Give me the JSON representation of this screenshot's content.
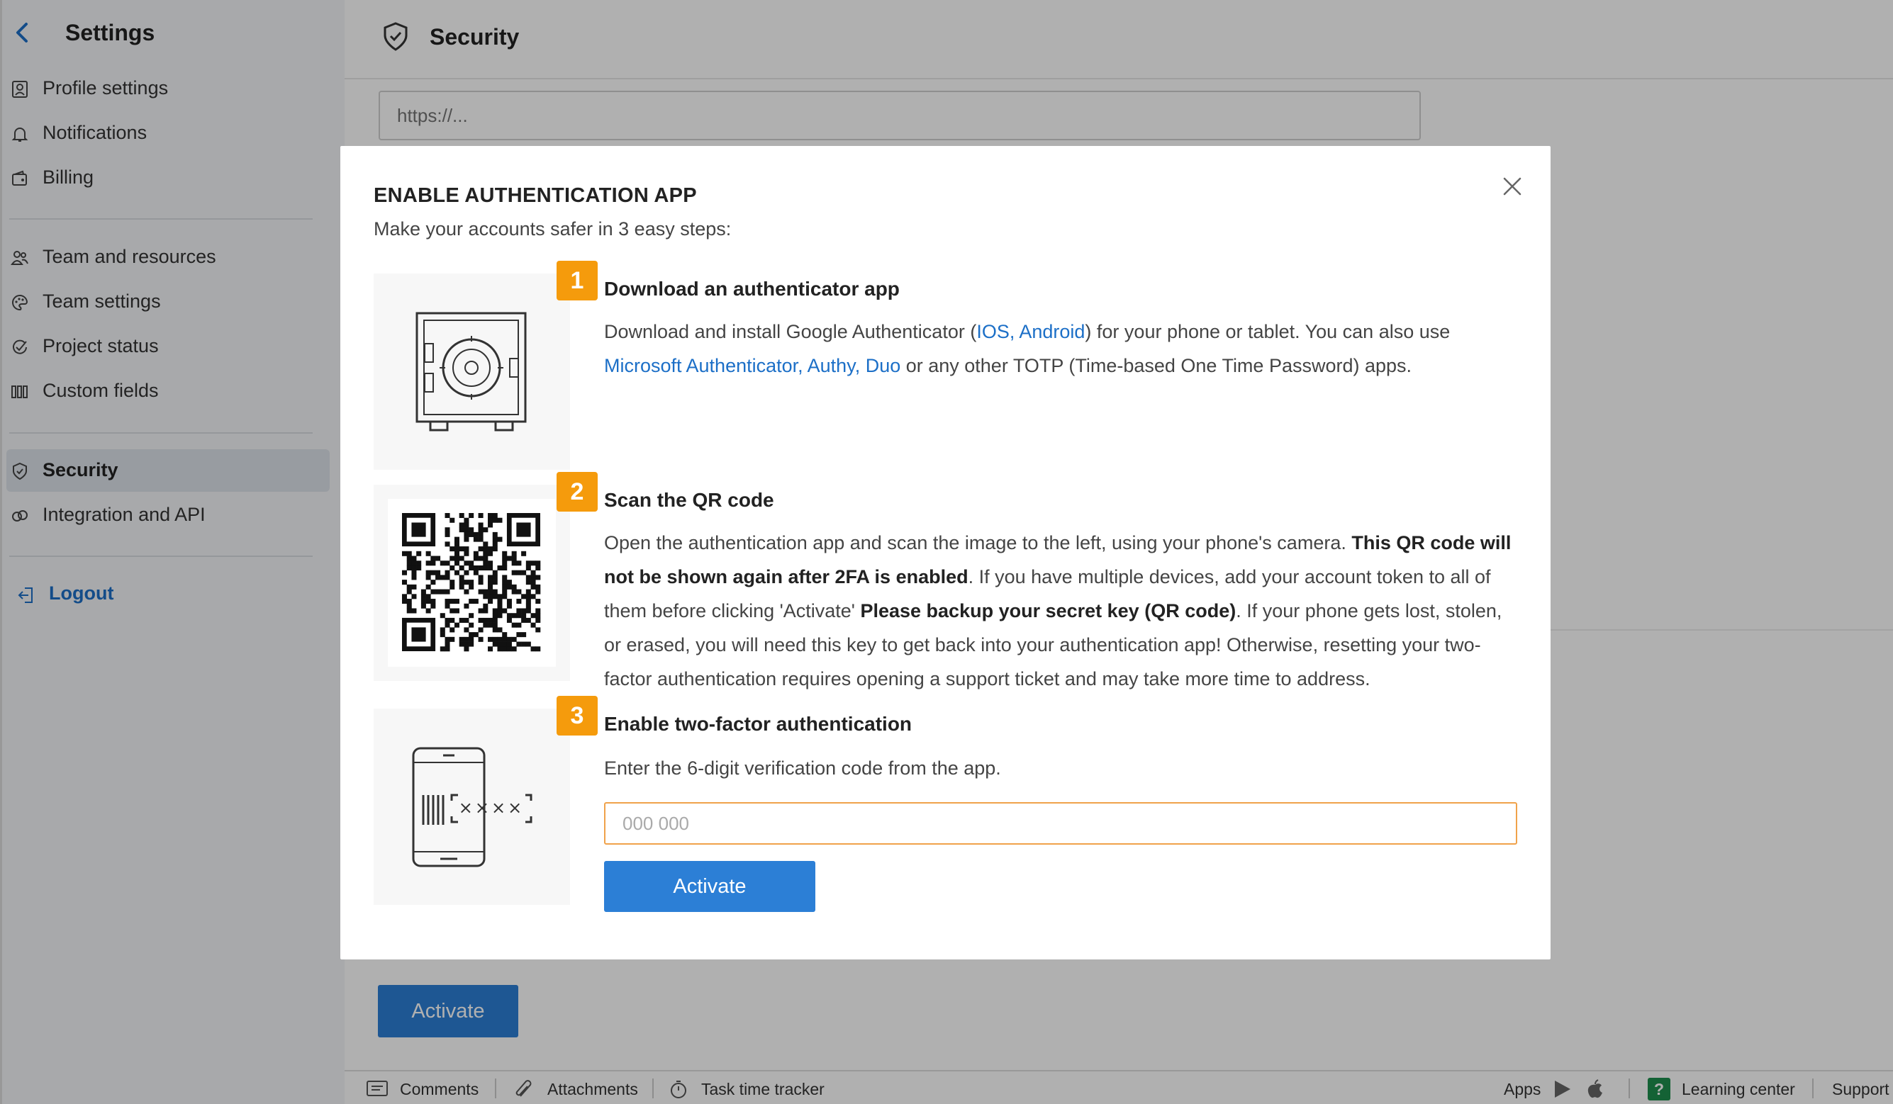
{
  "sidebar": {
    "title": "Settings",
    "items": [
      {
        "label": "Profile settings",
        "icon": "profile-icon"
      },
      {
        "label": "Notifications",
        "icon": "bell-icon"
      },
      {
        "label": "Billing",
        "icon": "wallet-icon"
      },
      {
        "label": "Team and resources",
        "icon": "team-icon"
      },
      {
        "label": "Team settings",
        "icon": "palette-icon"
      },
      {
        "label": "Project status",
        "icon": "status-icon"
      },
      {
        "label": "Custom fields",
        "icon": "columns-icon"
      },
      {
        "label": "Security",
        "icon": "shield-icon",
        "active": true
      },
      {
        "label": "Integration and API",
        "icon": "link-icon"
      }
    ],
    "logout": "Logout"
  },
  "main": {
    "title": "Security",
    "url_placeholder": "https://...",
    "activate_label": "Activate"
  },
  "footer": {
    "comments": "Comments",
    "attachments": "Attachments",
    "task_time_tracker": "Task time tracker",
    "apps": "Apps",
    "learning_center": "Learning center",
    "support": "Support"
  },
  "modal": {
    "title": "ENABLE AUTHENTICATION APP",
    "subtitle": "Make your accounts safer in 3 easy steps:",
    "steps": [
      {
        "number": "1",
        "title": "Download an authenticator app",
        "text_1": "Download and install Google Authenticator (",
        "link_1": "IOS, Android",
        "text_2": ") for your phone or tablet. You can also use ",
        "link_2": "Microsoft Authenticator, Authy, Duo",
        "text_3": " or any other TOTP (Time-based One Time Password) apps."
      },
      {
        "number": "2",
        "title": "Scan the QR code",
        "text_1": "Open the authentication app and scan the image to the left, using your phone's camera. ",
        "bold_1": "This QR code will not be shown again after 2FA is enabled",
        "text_2": ". If you have multiple devices, add your account token to all of them before clicking 'Activate' ",
        "bold_2": "Please backup your secret key (QR code)",
        "text_3": ". If your phone gets lost, stolen, or erased, you will need this key to get back into your authentication app! Otherwise, resetting your two-factor authentication requires opening a support ticket and may take more time to address."
      },
      {
        "number": "3",
        "title": "Enable two-factor authentication",
        "text": "Enter the 6-digit verification code from the app.",
        "placeholder": "000 000",
        "button": "Activate"
      }
    ]
  },
  "colors": {
    "accent": "#2c7fd6",
    "badge": "#f59b0c",
    "link": "#1c6fc7",
    "input_border": "#f0a24a"
  }
}
